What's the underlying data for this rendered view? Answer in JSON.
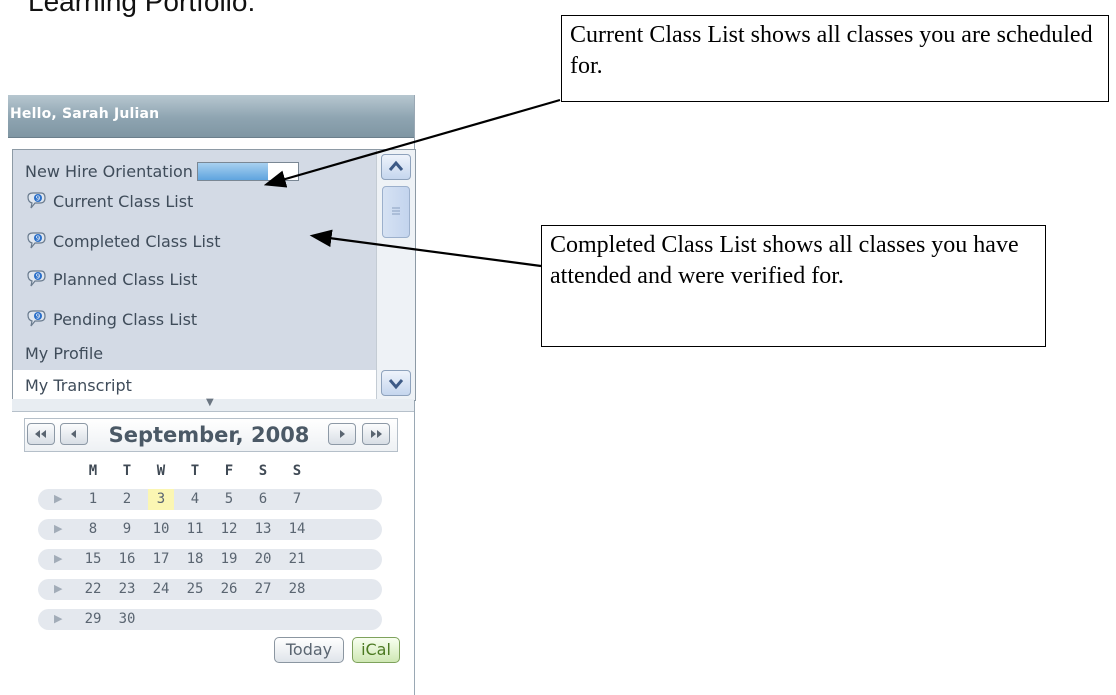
{
  "heading": "Learning Portfolio:",
  "panel": {
    "greeting": "Hello, Sarah Julian",
    "list_items": [
      {
        "label": "New Hire Orientation",
        "icon": "none",
        "progress": 0.7
      },
      {
        "label": "Current Class List",
        "icon": "speech-bubble-icon"
      },
      {
        "label": "Completed Class List",
        "icon": "speech-bubble-icon"
      },
      {
        "label": "Planned Class List",
        "icon": "speech-bubble-icon"
      },
      {
        "label": "Pending Class List",
        "icon": "speech-bubble-icon"
      },
      {
        "label": "My Profile",
        "icon": "none"
      },
      {
        "label": "My Transcript",
        "icon": "none"
      }
    ],
    "splitter_arrow": "▼"
  },
  "calendar": {
    "title": "September, 2008",
    "days_of_week": [
      "M",
      "T",
      "W",
      "T",
      "F",
      "S",
      "S"
    ],
    "weeks": [
      [
        "1",
        "2",
        "3",
        "4",
        "5",
        "6",
        "7"
      ],
      [
        "8",
        "9",
        "10",
        "11",
        "12",
        "13",
        "14"
      ],
      [
        "15",
        "16",
        "17",
        "18",
        "19",
        "20",
        "21"
      ],
      [
        "22",
        "23",
        "24",
        "25",
        "26",
        "27",
        "28"
      ],
      [
        "29",
        "30"
      ]
    ],
    "highlighted_day": "3",
    "today_label": "Today",
    "ical_label": "iCal"
  },
  "callouts": {
    "current": "Current Class List shows all classes you are scheduled for.",
    "completed": "Completed Class List shows all classes you have attended and were verified for."
  },
  "colors": {
    "header_bg": "#8ea4b1",
    "list_bg": "#d3dae5",
    "highlight_day": "#fbf6b3",
    "ical_green": "#4c7a22"
  }
}
